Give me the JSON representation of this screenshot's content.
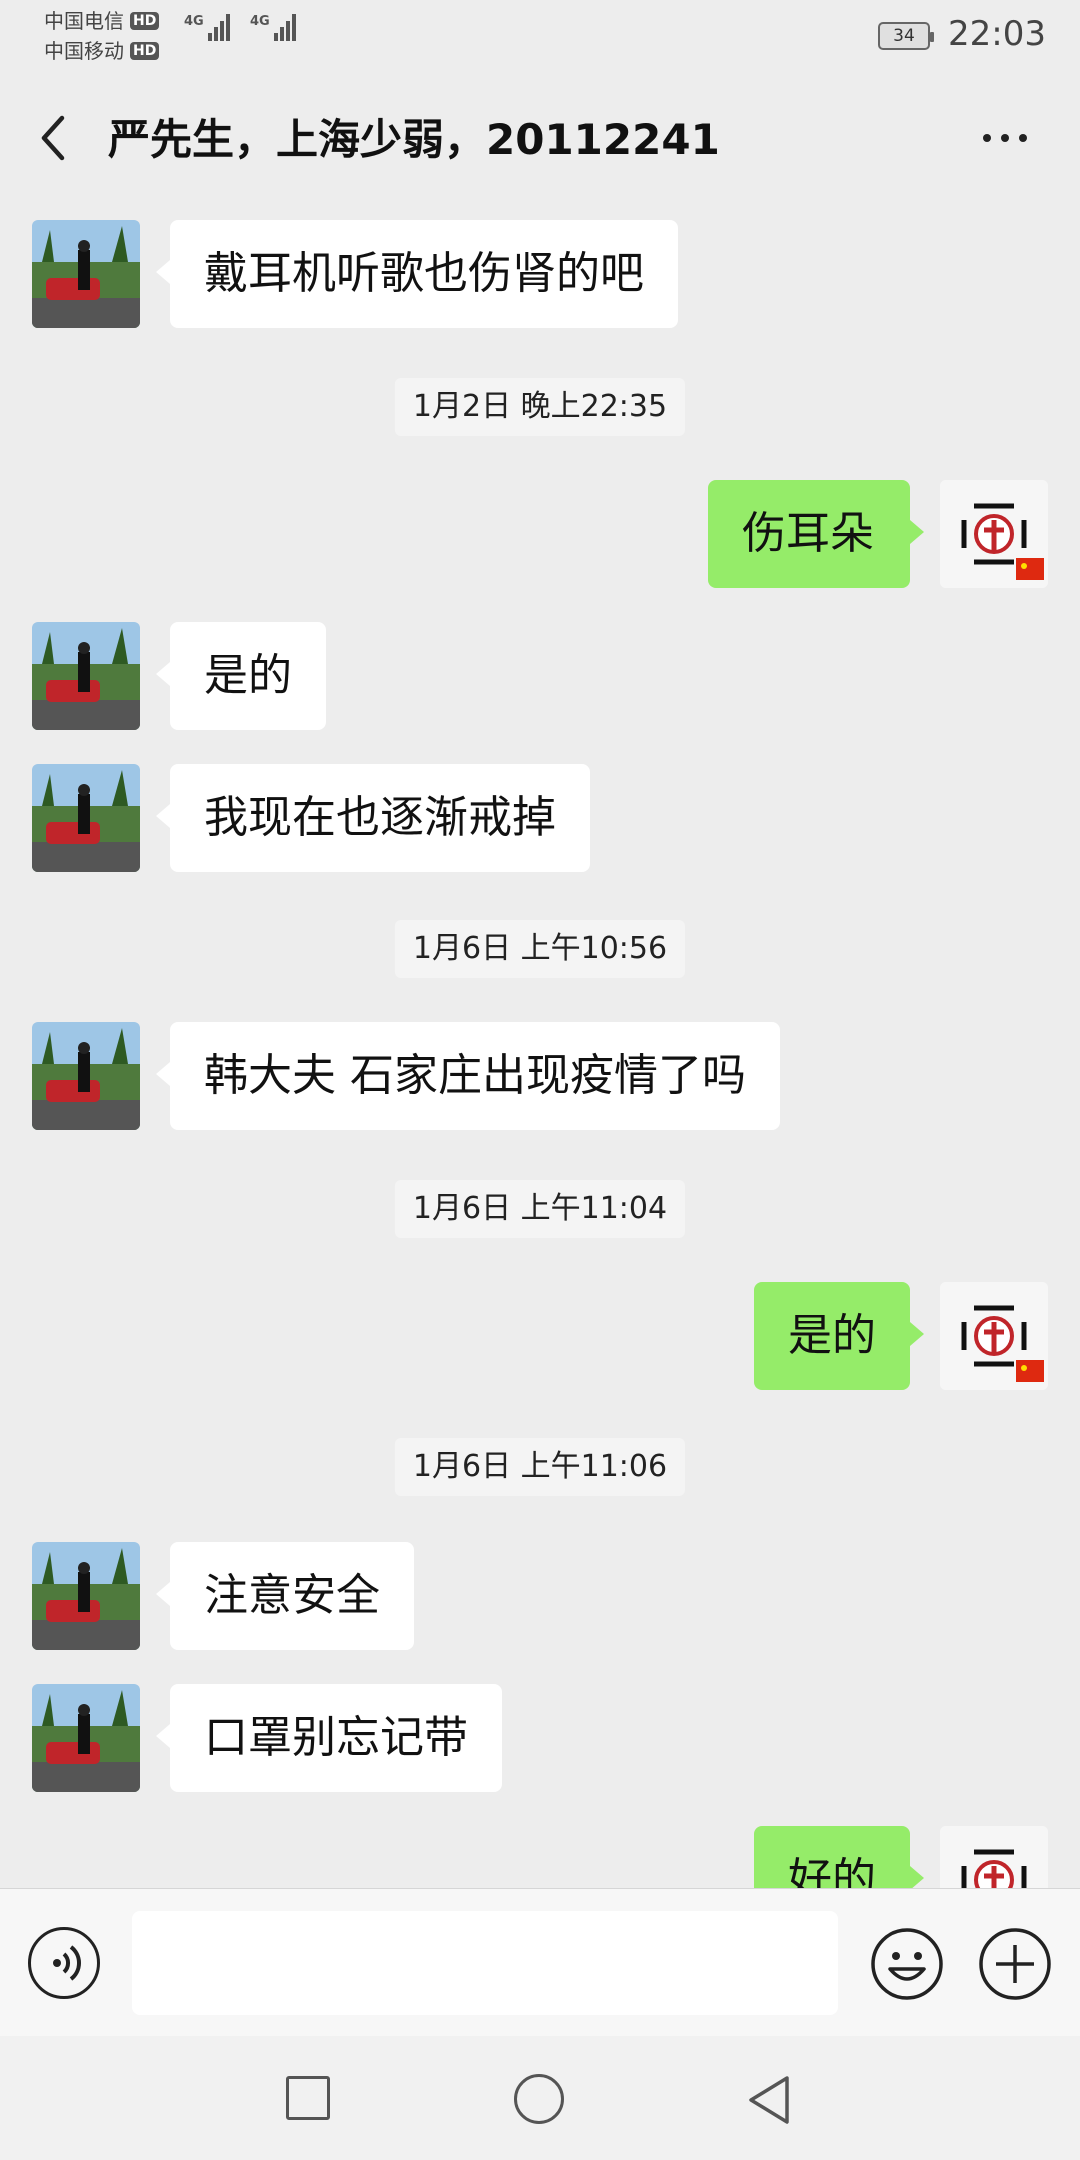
{
  "status_bar": {
    "carrier_1": "中国电信",
    "carrier_2": "中国移动",
    "hd_badge": "HD",
    "network_1": "4G",
    "network_2": "4G",
    "battery": "34",
    "time": "22:03"
  },
  "header": {
    "title": "严先生，上海少弱，20112241"
  },
  "messages": [
    {
      "type": "text",
      "side": "left",
      "text": "戴耳机听歌也伤肾的吧"
    },
    {
      "type": "time",
      "text": "1月2日 晚上22:35"
    },
    {
      "type": "text",
      "side": "right",
      "text": "伤耳朵"
    },
    {
      "type": "text",
      "side": "left",
      "text": "是的"
    },
    {
      "type": "text",
      "side": "left",
      "text": "我现在也逐渐戒掉"
    },
    {
      "type": "time",
      "text": "1月6日 上午10:56"
    },
    {
      "type": "text",
      "side": "left",
      "text": "韩大夫 石家庄出现疫情了吗"
    },
    {
      "type": "time",
      "text": "1月6日 上午11:04"
    },
    {
      "type": "text",
      "side": "right",
      "text": "是的"
    },
    {
      "type": "time",
      "text": "1月6日 上午11:06"
    },
    {
      "type": "text",
      "side": "left",
      "text": "注意安全"
    },
    {
      "type": "text",
      "side": "left",
      "text": "口罩别忘记带"
    },
    {
      "type": "text",
      "side": "right",
      "text": "好的"
    }
  ],
  "colors": {
    "background": "#ededed",
    "outgoing_bubble": "#95ec69",
    "incoming_bubble": "#ffffff"
  },
  "icons": {
    "back": "chevron-left-icon",
    "more": "more-dots-icon",
    "voice": "voice-icon",
    "emoji": "emoji-icon",
    "plus": "plus-icon"
  }
}
